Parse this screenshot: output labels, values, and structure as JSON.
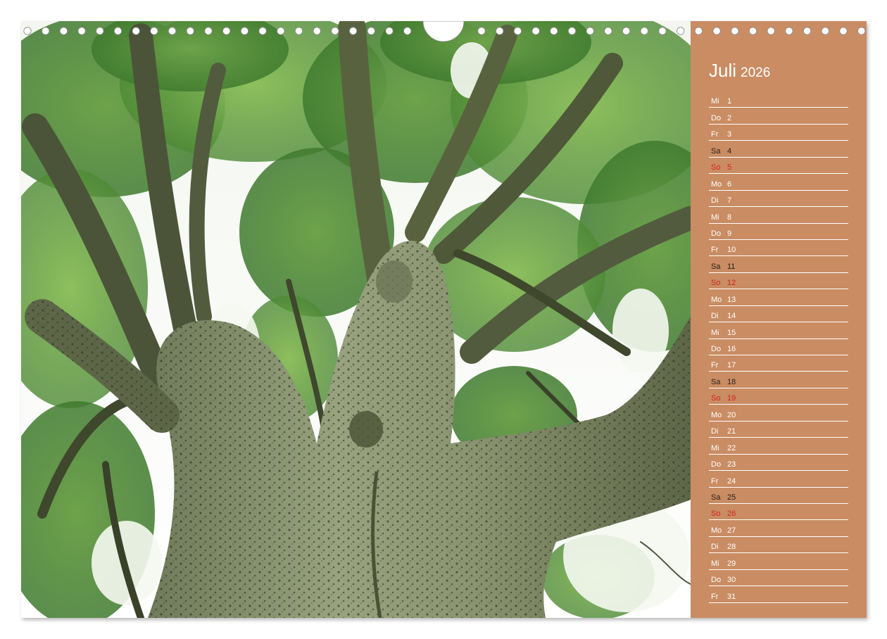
{
  "calendar": {
    "month": "Juli",
    "year": "2026",
    "days": [
      {
        "wd": "Mi",
        "num": "1",
        "type": "weekday"
      },
      {
        "wd": "Do",
        "num": "2",
        "type": "weekday"
      },
      {
        "wd": "Fr",
        "num": "3",
        "type": "weekday"
      },
      {
        "wd": "Sa",
        "num": "4",
        "type": "sat"
      },
      {
        "wd": "So",
        "num": "5",
        "type": "sun"
      },
      {
        "wd": "Mo",
        "num": "6",
        "type": "weekday"
      },
      {
        "wd": "Di",
        "num": "7",
        "type": "weekday"
      },
      {
        "wd": "Mi",
        "num": "8",
        "type": "weekday"
      },
      {
        "wd": "Do",
        "num": "9",
        "type": "weekday"
      },
      {
        "wd": "Fr",
        "num": "10",
        "type": "weekday"
      },
      {
        "wd": "Sa",
        "num": "11",
        "type": "sat"
      },
      {
        "wd": "So",
        "num": "12",
        "type": "sun"
      },
      {
        "wd": "Mo",
        "num": "13",
        "type": "weekday"
      },
      {
        "wd": "Di",
        "num": "14",
        "type": "weekday"
      },
      {
        "wd": "Mi",
        "num": "15",
        "type": "weekday"
      },
      {
        "wd": "Do",
        "num": "16",
        "type": "weekday"
      },
      {
        "wd": "Fr",
        "num": "17",
        "type": "weekday"
      },
      {
        "wd": "Sa",
        "num": "18",
        "type": "sat"
      },
      {
        "wd": "So",
        "num": "19",
        "type": "sun"
      },
      {
        "wd": "Mo",
        "num": "20",
        "type": "weekday"
      },
      {
        "wd": "Di",
        "num": "21",
        "type": "weekday"
      },
      {
        "wd": "Mi",
        "num": "22",
        "type": "weekday"
      },
      {
        "wd": "Do",
        "num": "23",
        "type": "weekday"
      },
      {
        "wd": "Fr",
        "num": "24",
        "type": "weekday"
      },
      {
        "wd": "Sa",
        "num": "25",
        "type": "sat"
      },
      {
        "wd": "So",
        "num": "26",
        "type": "sun"
      },
      {
        "wd": "Mo",
        "num": "27",
        "type": "weekday"
      },
      {
        "wd": "Di",
        "num": "28",
        "type": "weekday"
      },
      {
        "wd": "Mi",
        "num": "29",
        "type": "weekday"
      },
      {
        "wd": "Do",
        "num": "30",
        "type": "weekday"
      },
      {
        "wd": "Fr",
        "num": "31",
        "type": "weekday"
      }
    ]
  },
  "photo": {
    "subject": "spiny-trunk-tree-canopy-photo"
  },
  "colors": {
    "sidebar": "#c98c63",
    "sunday": "#d42222",
    "saturday": "#2a2018",
    "weekday": "#ffffff"
  }
}
